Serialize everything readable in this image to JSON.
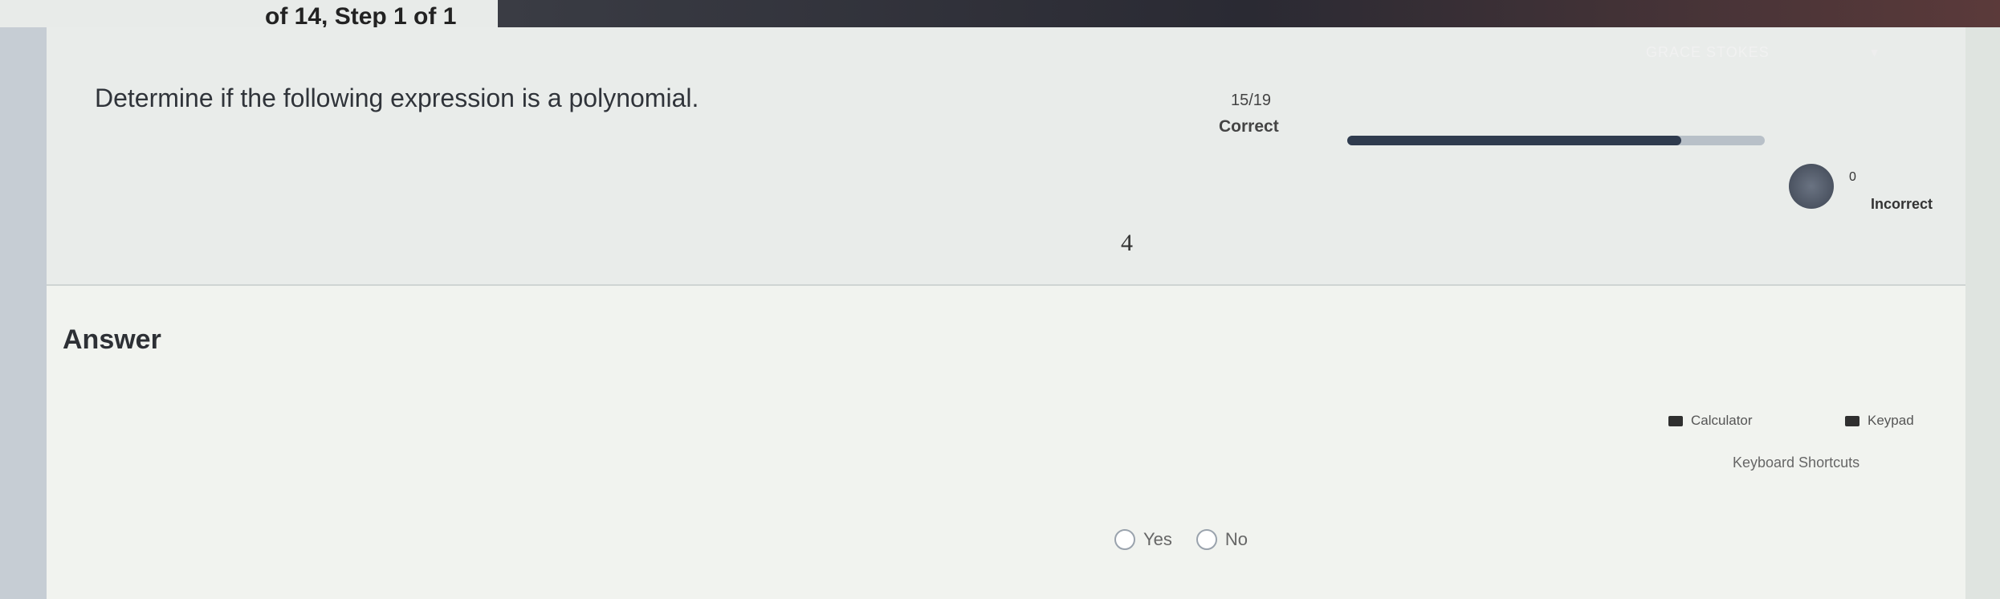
{
  "header": {
    "step": "of 14, Step 1 of 1"
  },
  "question": {
    "prompt": "Determine if the following expression is a polynomial.",
    "expression": "4"
  },
  "progress": {
    "score": "15/19",
    "correct_label": "Correct",
    "fill_fraction": 0.8,
    "incorrect_count": "0",
    "incorrect_label": "Incorrect"
  },
  "user": {
    "name": "GRACE STOKES"
  },
  "answer": {
    "label": "Answer",
    "choices": [
      {
        "label": "Yes"
      },
      {
        "label": "No"
      }
    ]
  },
  "tools": {
    "calculator": "Calculator",
    "keypad": "Keypad",
    "shortcuts": "Keyboard Shortcuts"
  }
}
